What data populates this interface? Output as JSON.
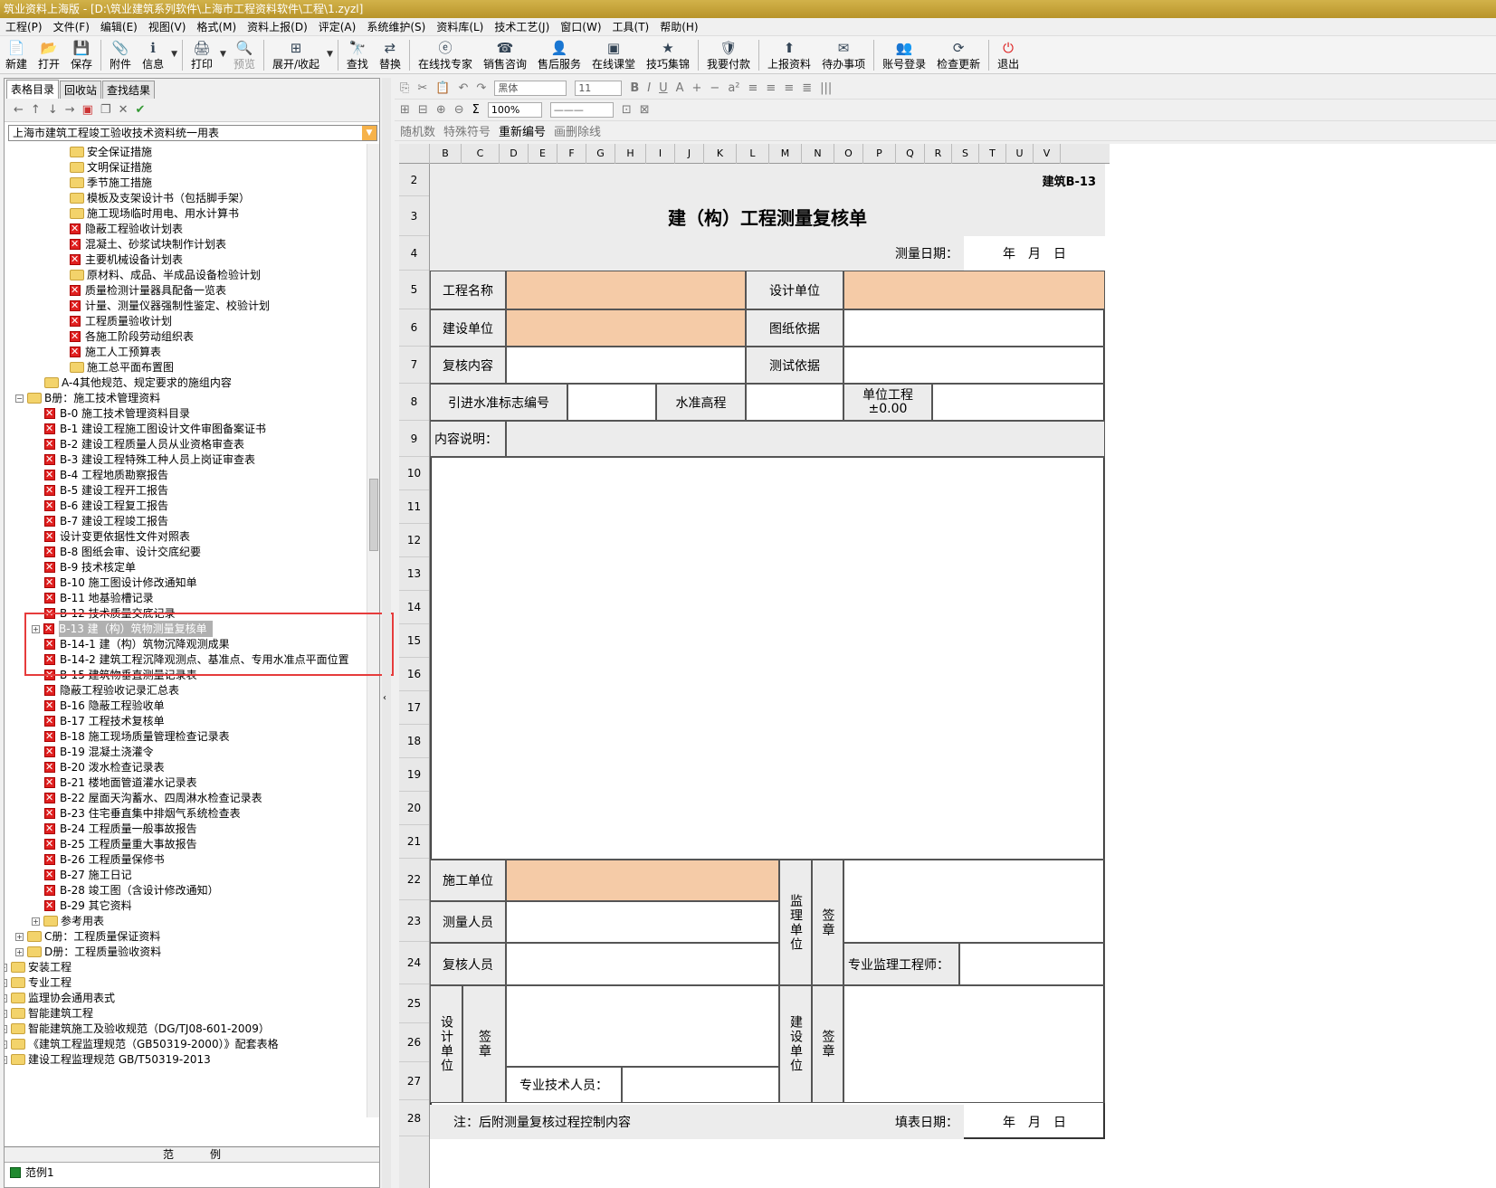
{
  "window": {
    "title": "筑业资料上海版 - [D:\\筑业建筑系列软件\\上海市工程资料软件\\工程\\1.zyzl]"
  },
  "menu": [
    "工程(P)",
    "文件(F)",
    "编辑(E)",
    "视图(V)",
    "格式(M)",
    "资料上报(D)",
    "评定(A)",
    "系统维护(S)",
    "资料库(L)",
    "技术工艺(J)",
    "窗口(W)",
    "工具(T)",
    "帮助(H)"
  ],
  "toolbar": [
    "新建",
    "打开",
    "保存",
    "附件",
    "信息",
    "打印",
    "预览",
    "展开/收起",
    "查找",
    "替换",
    "在线找专家",
    "销售咨询",
    "售后服务",
    "在线课堂",
    "技巧集锦",
    "我要付款",
    "上报资料",
    "待办事项",
    "账号登录",
    "检查更新",
    "退出"
  ],
  "left": {
    "tabs": [
      "表格目录",
      "回收站",
      "查找结果"
    ],
    "combo": "上海市建筑工程竣工验收技术资料统一用表",
    "tree": [
      {
        "t": "安全保证措施",
        "i": "folder",
        "lvl": 4
      },
      {
        "t": "文明保证措施",
        "i": "folder",
        "lvl": 4
      },
      {
        "t": "季节施工措施",
        "i": "folder",
        "lvl": 4
      },
      {
        "t": "模板及支架设计书（包括脚手架）",
        "i": "folder",
        "lvl": 4
      },
      {
        "t": "施工现场临时用电、用水计算书",
        "i": "folder",
        "lvl": 4
      },
      {
        "t": "隐蔽工程验收计划表",
        "i": "red",
        "lvl": 4
      },
      {
        "t": "混凝土、砂浆试块制作计划表",
        "i": "red",
        "lvl": 4
      },
      {
        "t": "主要机械设备计划表",
        "i": "red",
        "lvl": 4
      },
      {
        "t": "原材料、成品、半成品设备检验计划",
        "i": "folder",
        "lvl": 4
      },
      {
        "t": "质量检测计量器具配备一览表",
        "i": "red",
        "lvl": 4
      },
      {
        "t": "计量、测量仪器强制性鉴定、校验计划",
        "i": "red",
        "lvl": 4
      },
      {
        "t": "工程质量验收计划",
        "i": "red",
        "lvl": 4
      },
      {
        "t": "各施工阶段劳动组织表",
        "i": "red",
        "lvl": 4
      },
      {
        "t": "施工人工预算表",
        "i": "red",
        "lvl": 4
      },
      {
        "t": "施工总平面布置图",
        "i": "folder",
        "lvl": 4
      },
      {
        "t": "A-4其他规范、规定要求的施组内容",
        "i": "folder",
        "lvl": 3
      },
      {
        "t": "B册：施工技术管理资料",
        "i": "folder",
        "lvl": 2,
        "exp": "−"
      },
      {
        "t": "B-0 施工技术管理资料目录",
        "i": "red",
        "lvl": 3
      },
      {
        "t": "B-1 建设工程施工图设计文件审图备案证书",
        "i": "red",
        "lvl": 3
      },
      {
        "t": "B-2 建设工程质量人员从业资格审查表",
        "i": "red",
        "lvl": 3
      },
      {
        "t": "B-3 建设工程特殊工种人员上岗证审查表",
        "i": "red",
        "lvl": 3
      },
      {
        "t": "B-4 工程地质勘察报告",
        "i": "red",
        "lvl": 3
      },
      {
        "t": "B-5 建设工程开工报告",
        "i": "red",
        "lvl": 3
      },
      {
        "t": "B-6 建设工程复工报告",
        "i": "red",
        "lvl": 3
      },
      {
        "t": "B-7 建设工程竣工报告",
        "i": "red",
        "lvl": 3
      },
      {
        "t": "设计变更依据性文件对照表",
        "i": "red",
        "lvl": 3
      },
      {
        "t": "B-8 图纸会审、设计交底纪要",
        "i": "red",
        "lvl": 3
      },
      {
        "t": "B-9 技术核定单",
        "i": "red",
        "lvl": 3
      },
      {
        "t": "B-10 施工图设计修改通知单",
        "i": "red",
        "lvl": 3
      },
      {
        "t": "B-11 地基验槽记录",
        "i": "red",
        "lvl": 3
      },
      {
        "t": "B-12 技术质量交底记录",
        "i": "red",
        "lvl": 3
      },
      {
        "t": "B-13 建（构）筑物测量复核单",
        "i": "red",
        "lvl": 3,
        "exp": "+",
        "sel": true
      },
      {
        "t": "B-14-1 建（构）筑物沉降观测成果",
        "i": "red",
        "lvl": 3
      },
      {
        "t": "B-14-2 建筑工程沉降观测点、基准点、专用水准点平面位置",
        "i": "red",
        "lvl": 3
      },
      {
        "t": "B-15 建筑物垂直测量记录表",
        "i": "red",
        "lvl": 3
      },
      {
        "t": "隐蔽工程验收记录汇总表",
        "i": "red",
        "lvl": 3
      },
      {
        "t": "B-16 隐蔽工程验收单",
        "i": "red",
        "lvl": 3
      },
      {
        "t": "B-17 工程技术复核单",
        "i": "red",
        "lvl": 3
      },
      {
        "t": "B-18 施工现场质量管理检查记录表",
        "i": "red",
        "lvl": 3
      },
      {
        "t": "B-19 混凝土浇灌令",
        "i": "red",
        "lvl": 3
      },
      {
        "t": "B-20 泼水检查记录表",
        "i": "red",
        "lvl": 3
      },
      {
        "t": "B-21 楼地面管道灌水记录表",
        "i": "red",
        "lvl": 3
      },
      {
        "t": "B-22 屋面天沟蓄水、四周淋水检查记录表",
        "i": "red",
        "lvl": 3
      },
      {
        "t": "B-23 住宅垂直集中排烟气系统检查表",
        "i": "red",
        "lvl": 3
      },
      {
        "t": "B-24 工程质量一般事故报告",
        "i": "red",
        "lvl": 3
      },
      {
        "t": "B-25 工程质量重大事故报告",
        "i": "red",
        "lvl": 3
      },
      {
        "t": "B-26 工程质量保修书",
        "i": "red",
        "lvl": 3
      },
      {
        "t": "B-27 施工日记",
        "i": "red",
        "lvl": 3
      },
      {
        "t": "B-28 竣工图（含设计修改通知）",
        "i": "red",
        "lvl": 3
      },
      {
        "t": "B-29 其它资料",
        "i": "red",
        "lvl": 3
      },
      {
        "t": "参考用表",
        "i": "folder",
        "lvl": 3,
        "exp": "+"
      },
      {
        "t": "C册：工程质量保证资料",
        "i": "folder",
        "lvl": 2,
        "exp": "+"
      },
      {
        "t": "D册：工程质量验收资料",
        "i": "folder",
        "lvl": 2,
        "exp": "+"
      },
      {
        "t": "安装工程",
        "i": "folder",
        "lvl": 1,
        "exp": "+"
      },
      {
        "t": "专业工程",
        "i": "folder",
        "lvl": 1,
        "exp": "+"
      },
      {
        "t": "监理协会通用表式",
        "i": "folder",
        "lvl": 1,
        "exp": "+"
      },
      {
        "t": "智能建筑工程",
        "i": "folder",
        "lvl": 1,
        "exp": "+"
      },
      {
        "t": "智能建筑施工及验收规范（DG/TJ08-601-2009）",
        "i": "folder",
        "lvl": 1,
        "exp": "+"
      },
      {
        "t": "《建筑工程监理规范（GB50319-2000）》配套表格",
        "i": "folder",
        "lvl": 1,
        "exp": "+"
      },
      {
        "t": "建设工程监理规范 GB/T50319-2013",
        "i": "folder",
        "lvl": 1,
        "exp": "+"
      }
    ],
    "example_header": [
      "范",
      "例"
    ],
    "example_item": "范例1"
  },
  "format_toolbar": {
    "font": "黑体",
    "size": "11",
    "zoom": "100%"
  },
  "insert_toolbar": [
    "随机数",
    "特殊符号",
    "重新编号",
    "画删除线"
  ],
  "columns": [
    "B",
    "C",
    "D",
    "E",
    "F",
    "G",
    "H",
    "I",
    "J",
    "K",
    "L",
    "M",
    "N",
    "O",
    "P",
    "Q",
    "R",
    "S",
    "T",
    "U",
    "V"
  ],
  "rows": [
    "2",
    "3",
    "4",
    "5",
    "6",
    "7",
    "8",
    "9",
    "10",
    "11",
    "12",
    "13",
    "14",
    "15",
    "16",
    "17",
    "18",
    "19",
    "20",
    "21",
    "22",
    "23",
    "24",
    "25",
    "26",
    "27",
    "28"
  ],
  "form": {
    "code": "建筑B-13",
    "title": "建（构）工程测量复核单",
    "date_label": "测量日期：",
    "date_value": "年　月　日",
    "project_name": "工程名称",
    "design_unit": "设计单位",
    "build_unit": "建设单位",
    "drawing_basis": "图纸依据",
    "review_content": "复核内容",
    "test_basis": "测试依据",
    "benchmark_no": "引进水准标志编号",
    "benchmark_elev": "水准高程",
    "unit_project": "单位工程",
    "unit_zero": "±0.00",
    "content_desc": "内容说明：",
    "construction_unit": "施工单位",
    "surveyor": "测量人员",
    "reviewer": "复核人员",
    "supervision_unit": "监理单位",
    "seal": "签章",
    "supervisor_engineer": "专业监理工程师：",
    "design_unit_v": "设计单位",
    "build_unit_v": "建设单位",
    "tech_staff": "专业技术人员：",
    "note": "注：后附测量复核过程控制内容",
    "fill_date_label": "填表日期：",
    "fill_date_value": "年　月　日"
  }
}
